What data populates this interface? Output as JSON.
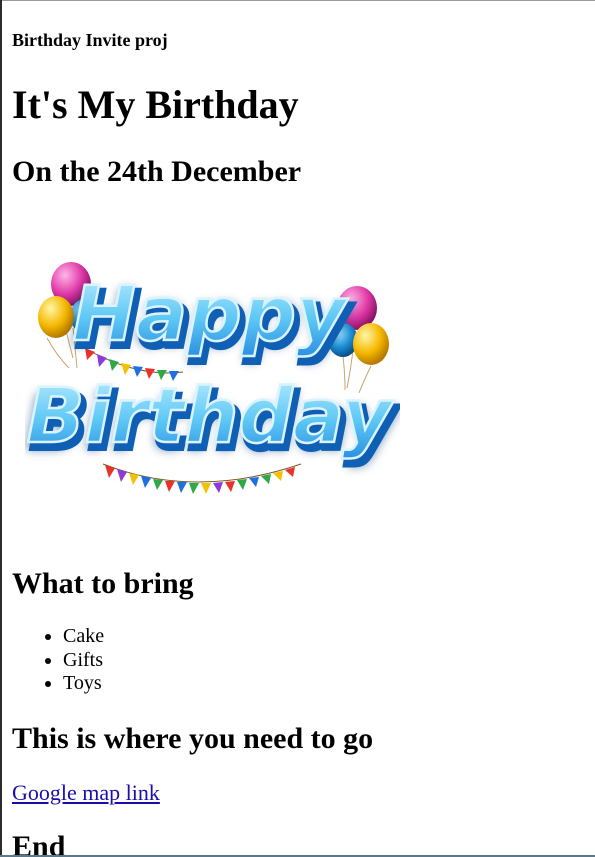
{
  "header": {
    "project_title": "Birthday Invite proj"
  },
  "main": {
    "title": "It's My Birthday",
    "date_heading": "On the 24th December",
    "image": {
      "line1": "Happy",
      "line2": "Birthday",
      "colors": {
        "text_fill": "#5ec8f5",
        "text_stroke": "#0f5fb5",
        "text_outline": "#d9f3ff",
        "shadow": "#0b3f7a"
      }
    },
    "bring_heading": "What to bring",
    "bring_items": [
      {
        "label": "Cake"
      },
      {
        "label": "Gifts"
      },
      {
        "label": "Toys"
      }
    ],
    "location_heading": "This is where you need to go",
    "map_link": "Google map link",
    "end_heading": "End"
  },
  "colors": {
    "link": "#1a0dab",
    "text": "#000000",
    "background": "#ffffff"
  }
}
